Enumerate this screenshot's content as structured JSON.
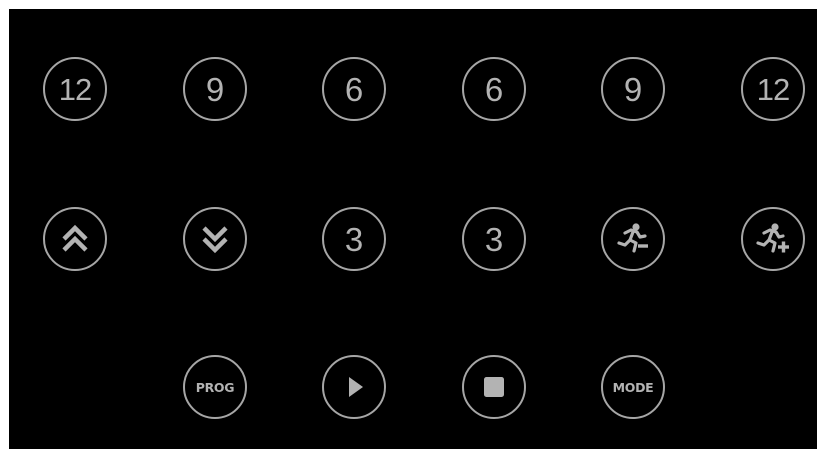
{
  "row_top": [
    {
      "label": "12",
      "name": "speed-12-left-button"
    },
    {
      "label": "9",
      "name": "speed-9-left-button"
    },
    {
      "label": "6",
      "name": "speed-6-left-button"
    },
    {
      "label": "6",
      "name": "incline-6-right-button"
    },
    {
      "label": "9",
      "name": "incline-9-right-button"
    },
    {
      "label": "12",
      "name": "incline-12-right-button"
    }
  ],
  "row_middle": {
    "left_number": "3",
    "right_number": "3"
  },
  "row_bottom": {
    "prog_label": "PROG",
    "mode_label": "MODE"
  },
  "icons": {
    "up": "chevron-double-up-icon",
    "down": "chevron-double-down-icon",
    "run_minus": "runner-minus-icon",
    "run_plus": "runner-plus-icon",
    "play": "play-icon",
    "stop": "stop-icon"
  },
  "colors": {
    "background": "#000000",
    "button_stroke": "#a6a6a6",
    "button_text": "#b3b3b3"
  }
}
